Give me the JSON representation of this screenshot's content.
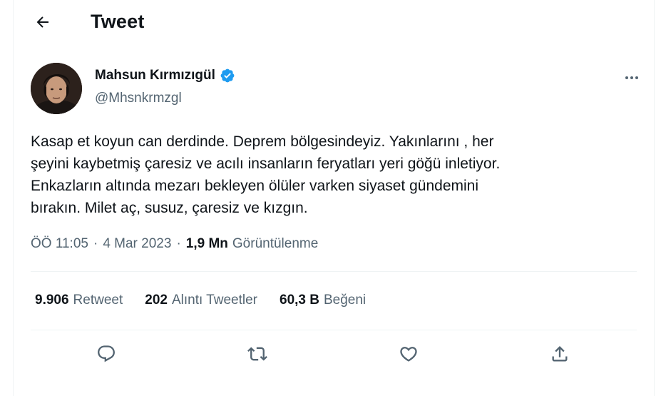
{
  "header": {
    "title": "Tweet",
    "back_icon": "arrow-left-icon"
  },
  "author": {
    "display_name": "Mahsun Kırmızıgül",
    "handle": "@Mhsnkrmzgl",
    "verified": true,
    "verified_color": "#1d9bf0"
  },
  "tweet": {
    "text": "Kasap et koyun can derdinde. Deprem bölgesindeyiz. Yakınlarını , her\nşeyini kaybetmiş çaresiz ve acılı insanların feryatları yeri göğü inletiyor.\nEnkazların altında mezarı bekleyen ölüler varken siyaset gündemini\nbırakın. Milet aç, susuz, çaresiz ve kızgın.",
    "time": "ÖÖ 11:05",
    "separator": "·",
    "date": "4 Mar 2023",
    "views_count": "1,9 Mn",
    "views_label": "Görüntülenme"
  },
  "stats": {
    "retweets": {
      "count": "9.906",
      "label": "Retweet"
    },
    "quotes": {
      "count": "202",
      "label": "Alıntı Tweetler"
    },
    "likes": {
      "count": "60,3 B",
      "label": "Beğeni"
    }
  },
  "actions": [
    "reply-icon",
    "retweet-icon",
    "like-icon",
    "share-icon"
  ],
  "colors": {
    "text": "#0f1419",
    "secondary": "#536471",
    "divider": "#eff3f4",
    "accent": "#1d9bf0"
  }
}
